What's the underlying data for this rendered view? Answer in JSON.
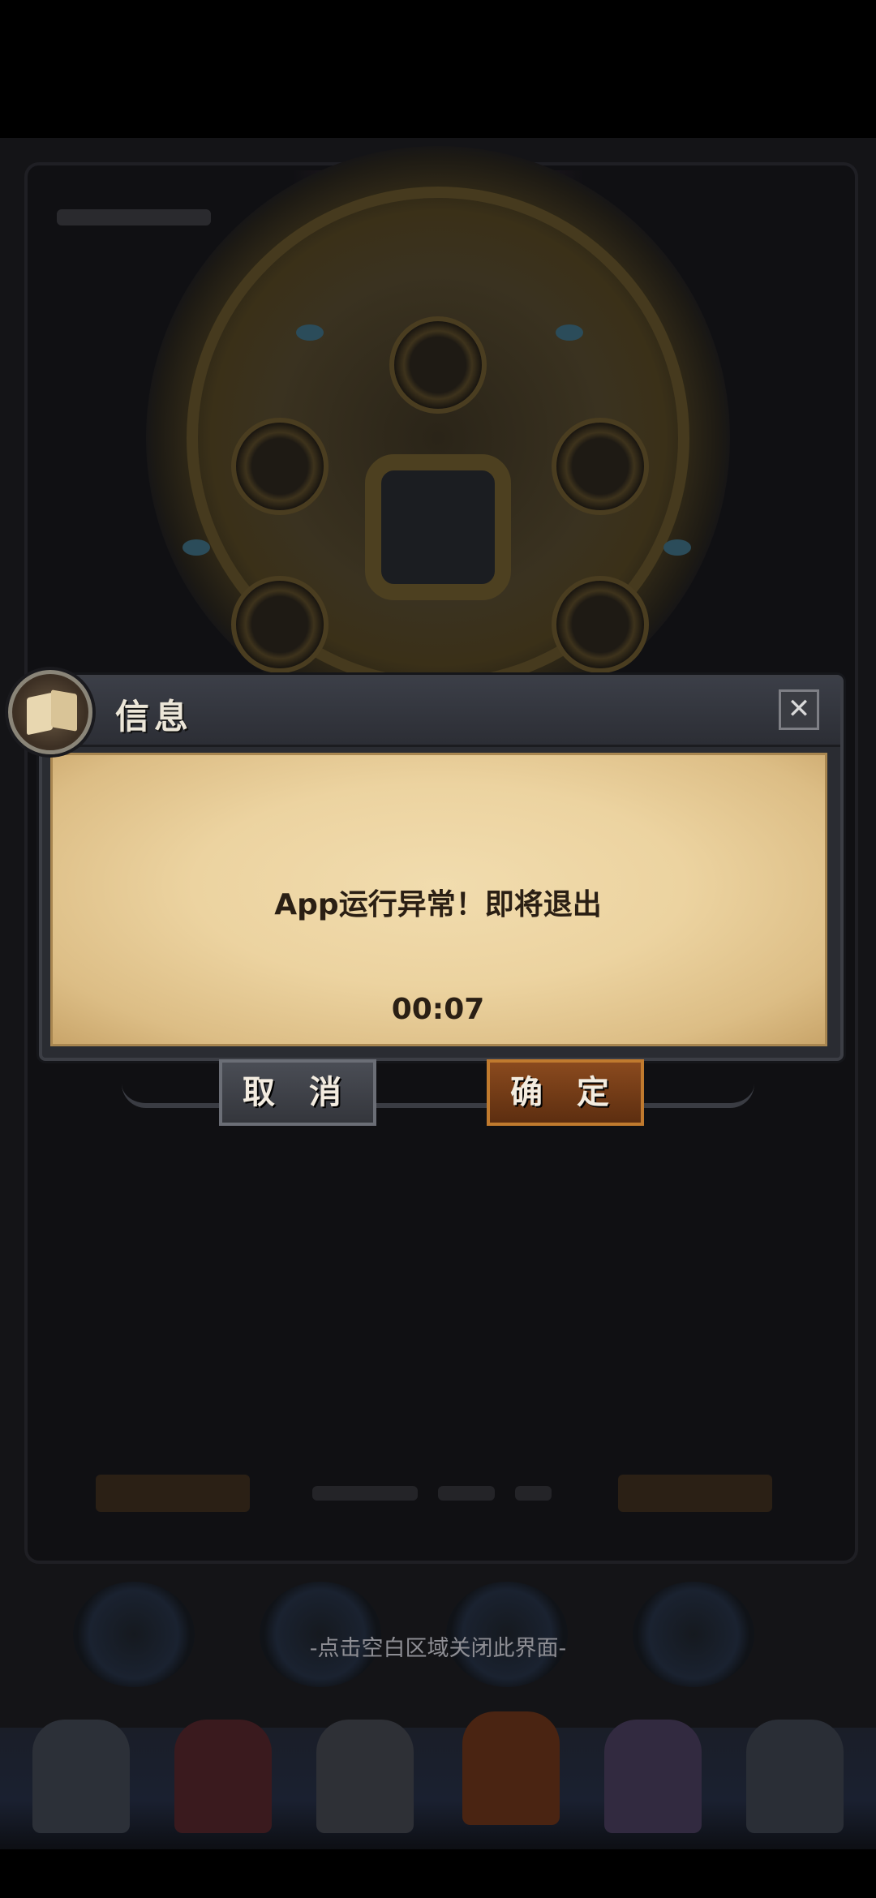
{
  "background": {
    "hint_text": "-点击空白区域关闭此界面-"
  },
  "dialog": {
    "title": "信息",
    "close_symbol": "✕",
    "message": "App运行异常！即将退出",
    "countdown": "00:07",
    "cancel_label": "取 消",
    "confirm_label": "确 定"
  },
  "icons": {
    "book": "book-icon",
    "close": "close-icon"
  },
  "colors": {
    "parchment": "#ecd3a0",
    "confirm_button": "#7a3f18",
    "cancel_button": "#41444b",
    "text_dark": "#2a1f14"
  }
}
